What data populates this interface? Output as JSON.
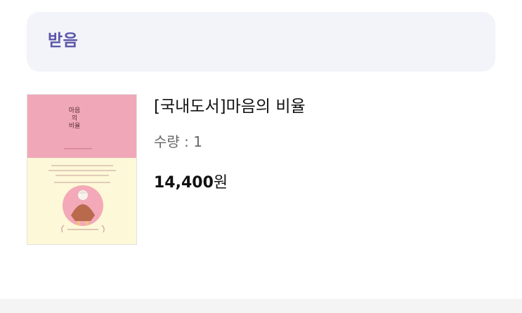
{
  "order_status": {
    "label": "받음"
  },
  "item": {
    "cover_title": "마음의 비율",
    "name": "[국내도서]마음의 비율",
    "quantity_text": "수량 : 1",
    "price_value": "14,400",
    "price_unit": "원"
  },
  "colors": {
    "status_text": "#5a56a8",
    "status_bg": "#f3f3fa",
    "cover_pink": "#f0a8b8",
    "cover_cream": "#fdf8d7"
  }
}
